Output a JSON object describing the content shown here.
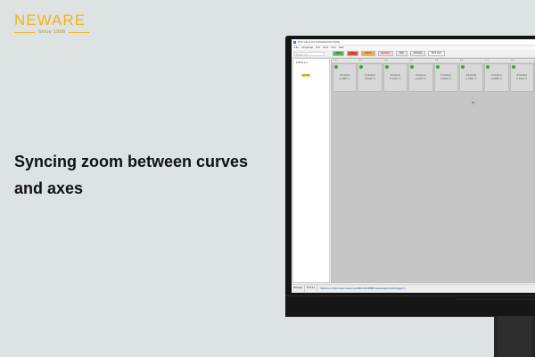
{
  "brand": {
    "name": "NEWARE",
    "since": "Since 1998",
    "color": "#f2b316"
  },
  "headline": {
    "line1": "Syncing zoom between curves",
    "line2": "and axes"
  },
  "app": {
    "window_title": "BTS Client 8.0.0.60(2024.06.13)(N)",
    "menu": [
      "File",
      "Language",
      "Set",
      "View",
      "Tool",
      "Help"
    ],
    "search_placeholder": "Device 1 ch",
    "toolbar": [
      {
        "label": "Start",
        "color": "#5cb85c"
      },
      {
        "label": "Stop",
        "color": "#e0533a"
      },
      {
        "label": "Pause",
        "color": "#f0ad4e"
      },
      {
        "label": "Resume",
        "color": "#f7d4d4"
      },
      {
        "label": "Skip",
        "color": "#e6e6ee"
      },
      {
        "label": "Finished",
        "color": "#e6e6ee"
      },
      {
        "label": "BTS View",
        "color": "#f5f5f5"
      }
    ],
    "tree": {
      "root": "BTS 2-1",
      "badge": "127.08"
    },
    "channel_header": [
      "1-1",
      "1-2",
      "1-3",
      "1-4",
      "1-5",
      "1-6",
      "1-7",
      "1-8"
    ],
    "channels": [
      {
        "status": "Finished",
        "voltage": "0.0007 V"
      },
      {
        "status": "Finished",
        "voltage": "0.0097 V"
      },
      {
        "status": "Finished",
        "voltage": "0.1007 V"
      },
      {
        "status": "Finished",
        "voltage": "0.2007 V"
      },
      {
        "status": "Finished",
        "voltage": "0.3097 V"
      },
      {
        "status": "Finished",
        "voltage": "0.3997 V"
      },
      {
        "status": "Finished",
        "voltage": "0.4887 V"
      },
      {
        "status": "Finished",
        "voltage": "0.1007 V"
      }
    ],
    "status_tabs": [
      "Message",
      "BTS 2-1"
    ],
    "status_message": "Welcome to https://www.neware.net(18B00-600-8BBB Neware/logfcom/bts8 logged in"
  }
}
